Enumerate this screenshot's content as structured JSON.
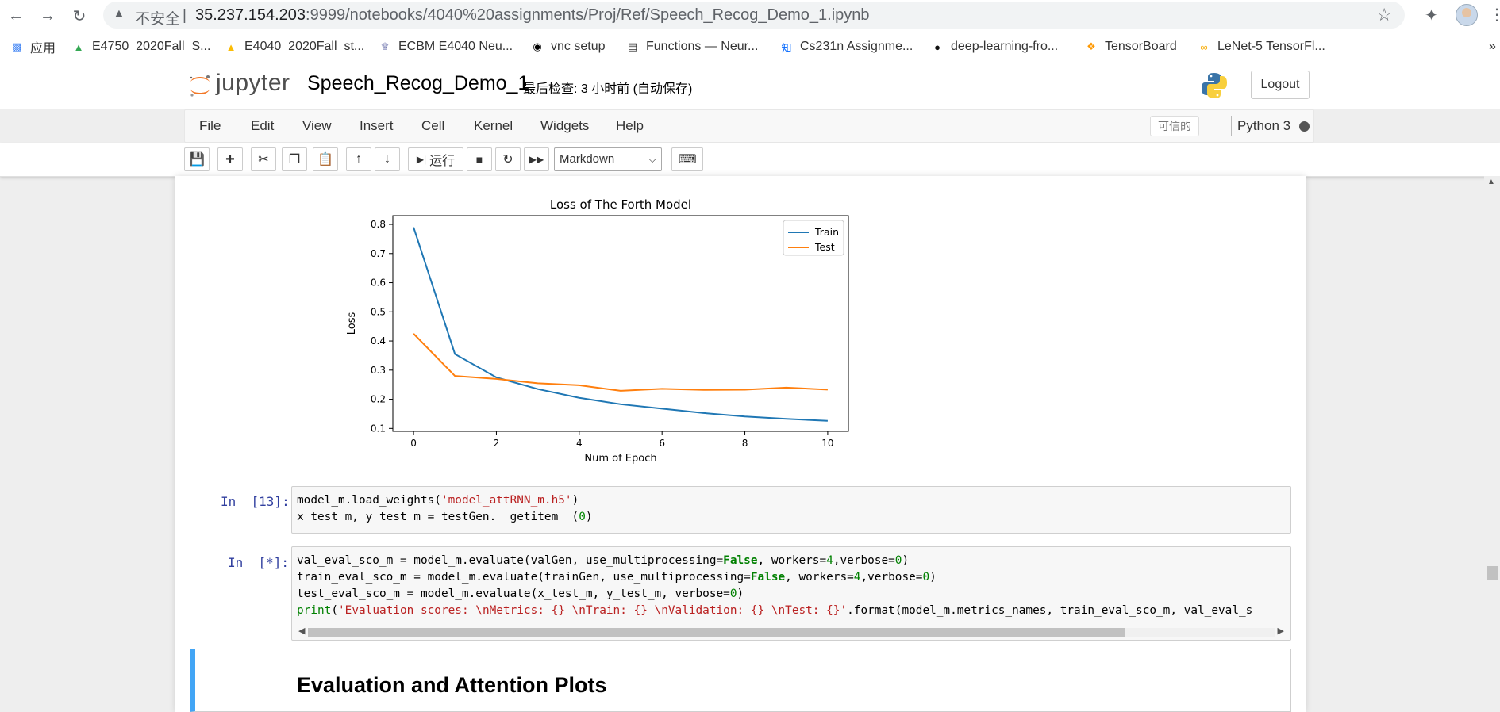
{
  "browser": {
    "insecure_label": "不安全",
    "url_host": "35.237.154.203",
    "url_rest": ":9999/notebooks/4040%20assignments/Proj/Ref/Speech_Recog_Demo_1.ipynb",
    "bookmarks": [
      {
        "label": "应用",
        "icon": "apps-grid-icon",
        "color": "#4285f4"
      },
      {
        "label": "E4750_2020Fall_S...",
        "icon": "google-drive-icon",
        "color": "#34a853"
      },
      {
        "label": "E4040_2020Fall_st...",
        "icon": "google-drive-icon",
        "color": "#fbbc04"
      },
      {
        "label": "ECBM E4040 Neu...",
        "icon": "columbia-crown-icon",
        "color": "#1a237e"
      },
      {
        "label": "vnc setup",
        "icon": "vnc-icon",
        "color": "#000000"
      },
      {
        "label": "Functions — Neur...",
        "icon": "book-icon",
        "color": "#333333"
      },
      {
        "label": "Cs231n Assignme...",
        "icon": "zhihu-icon",
        "color": "#0066ff"
      },
      {
        "label": "deep-learning-fro...",
        "icon": "github-icon",
        "color": "#111111"
      },
      {
        "label": "TensorBoard",
        "icon": "tensorflow-icon",
        "color": "#ff9800"
      },
      {
        "label": "LeNet-5 TensorFl...",
        "icon": "colab-icon",
        "color": "#f9ab00"
      }
    ]
  },
  "jupyter": {
    "logo_text": "jupyter",
    "notebook_title": "Speech_Recog_Demo_1",
    "checkpoint": "最后检查: 3 小时前 (自动保存)",
    "logout_label": "Logout",
    "menu": [
      "File",
      "Edit",
      "View",
      "Insert",
      "Cell",
      "Kernel",
      "Widgets",
      "Help"
    ],
    "trusted_label": "可信的",
    "kernel_name": "Python 3",
    "run_label": "运行",
    "cell_type": "Markdown"
  },
  "cells": {
    "cell13_prompt": "In  [13]:",
    "cell13_lines": [
      "model_m.load_weights('model_attRNN_m.h5')",
      "x_test_m, y_test_m = testGen.__getitem__(0)"
    ],
    "cell_star_prompt": "In  [*]:",
    "markdown_heading": "Evaluation and Attention Plots"
  },
  "chart_data": {
    "type": "line",
    "title": "Loss of The Forth Model",
    "xlabel": "Num of Epoch",
    "ylabel": "Loss",
    "x": [
      0,
      1,
      2,
      3,
      4,
      5,
      6,
      7,
      8,
      9,
      10
    ],
    "series": [
      {
        "name": "Train",
        "color": "#1f77b4",
        "values": [
          0.79,
          0.355,
          0.275,
          0.235,
          0.205,
          0.183,
          0.168,
          0.153,
          0.141,
          0.133,
          0.126
        ]
      },
      {
        "name": "Test",
        "color": "#ff7f0e",
        "values": [
          0.425,
          0.28,
          0.27,
          0.255,
          0.248,
          0.229,
          0.236,
          0.232,
          0.233,
          0.24,
          0.233
        ]
      }
    ],
    "xticks": [
      0,
      2,
      4,
      6,
      8,
      10
    ],
    "yticks": [
      0.1,
      0.2,
      0.3,
      0.4,
      0.5,
      0.6,
      0.7,
      0.8
    ],
    "xlim": [
      -0.5,
      10.5
    ],
    "ylim": [
      0.09,
      0.83
    ],
    "legend_position": "top-right",
    "grid": false
  }
}
